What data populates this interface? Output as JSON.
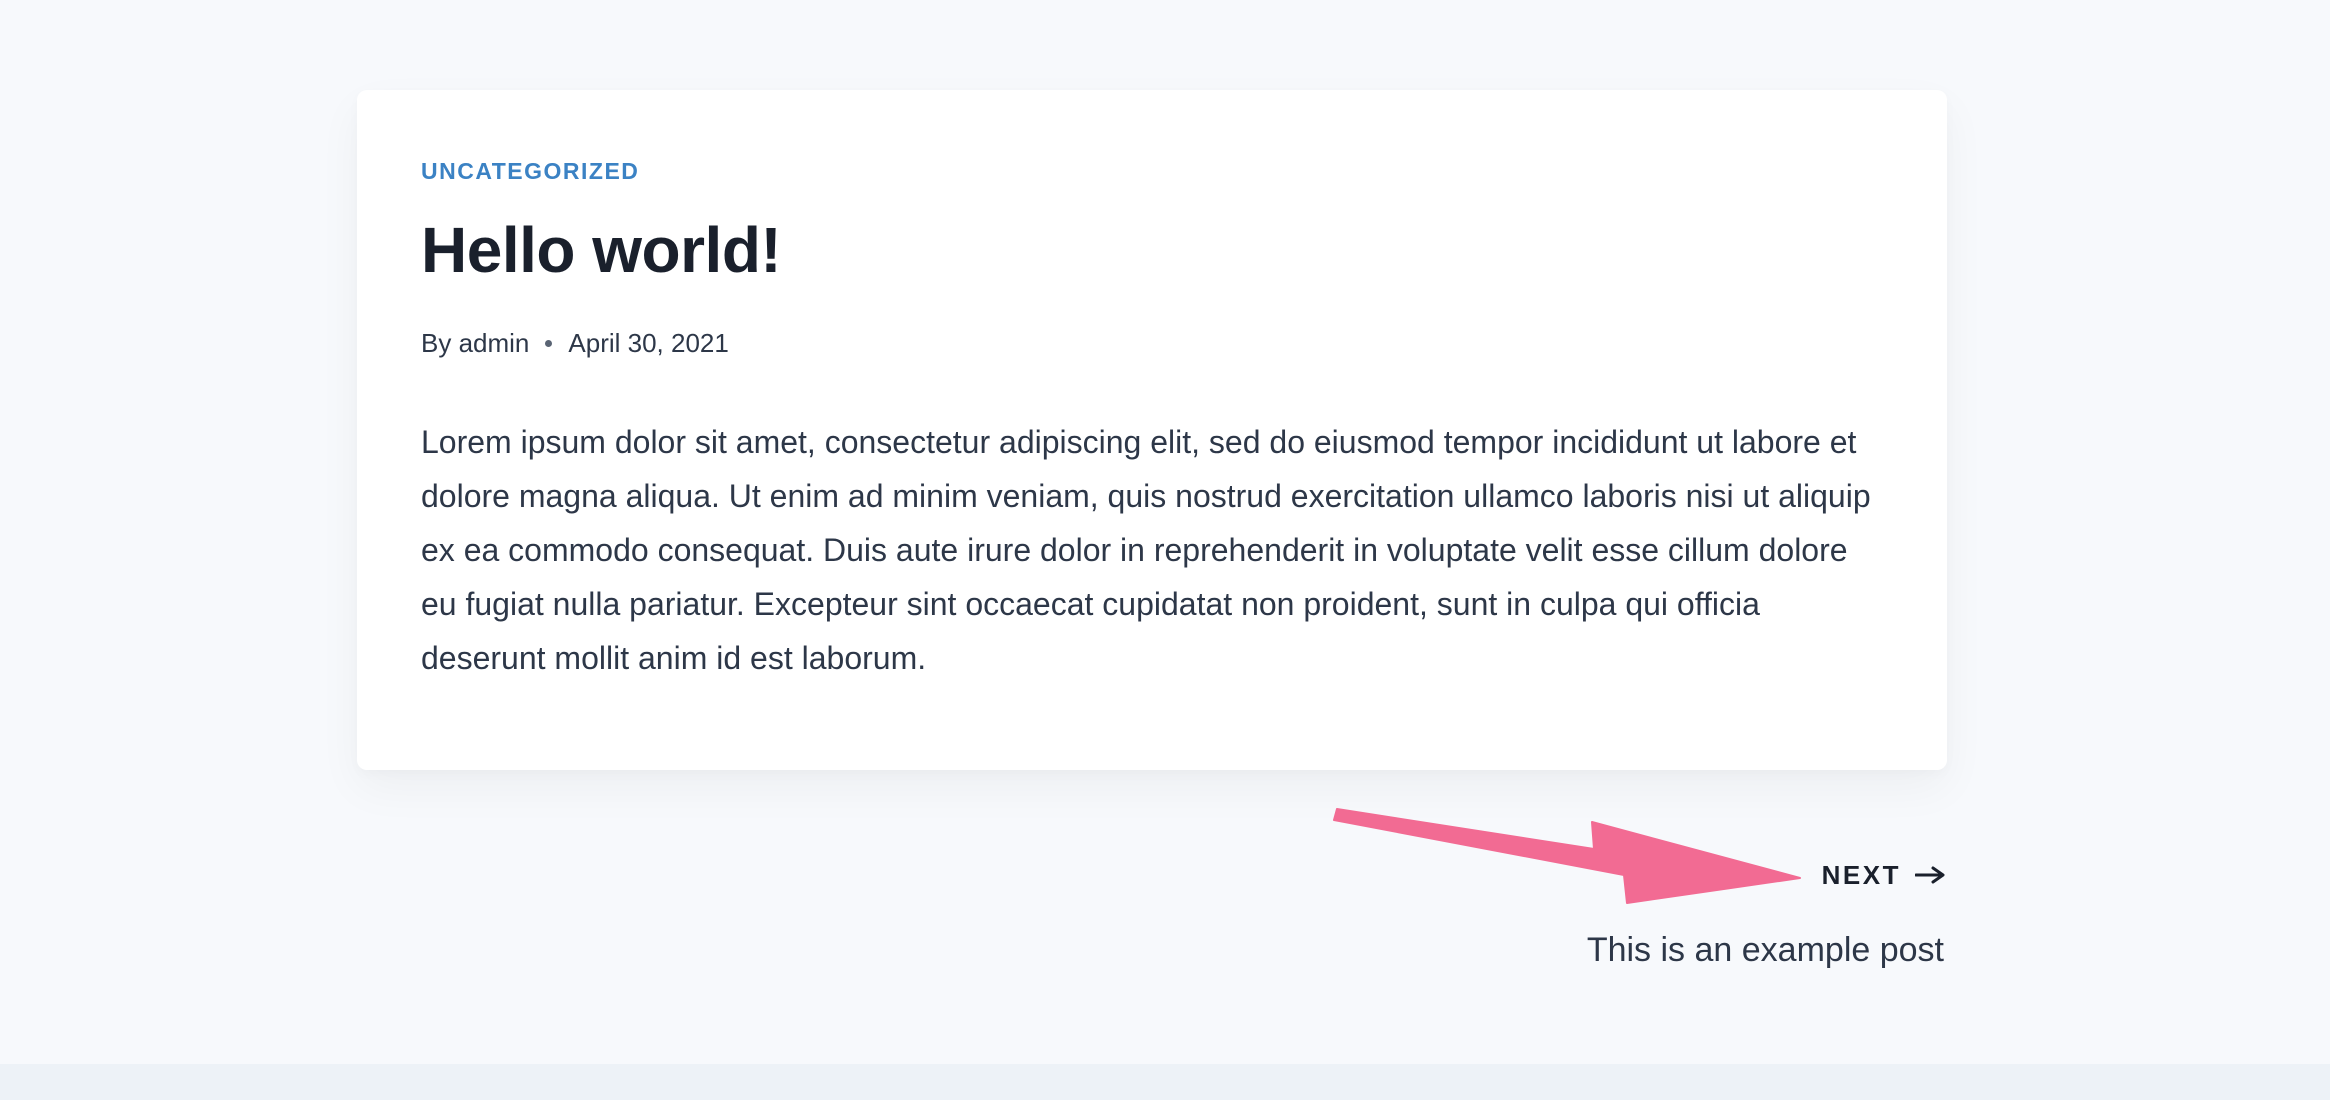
{
  "post": {
    "category": "UNCATEGORIZED",
    "title": "Hello world!",
    "author": "By admin",
    "date": "April 30, 2021",
    "excerpt": "Lorem ipsum dolor sit amet, consectetur adipiscing elit, sed do eiusmod tempor incididunt ut labore et dolore magna aliqua. Ut enim ad minim veniam, quis nostrud exercitation ullamco laboris nisi ut aliquip ex ea commodo consequat. Duis aute irure dolor in reprehenderit in voluptate velit esse cillum dolore eu fugiat nulla pariatur. Excepteur sint occaecat cupidatat non proident, sunt in culpa qui officia deserunt mollit anim id est laborum."
  },
  "navigation": {
    "next_label": "NEXT",
    "next_icon": "arrow-right-icon",
    "next_post_title": "This is an example post"
  },
  "annotation": {
    "icon": "pink-arrow-icon",
    "color": "#f26b93"
  },
  "colors": {
    "background": "#f7f9fc",
    "card": "#ffffff",
    "accent": "#3b82c4",
    "heading": "#1a202c",
    "text": "#2d3748",
    "footer": "#edf2f7"
  }
}
